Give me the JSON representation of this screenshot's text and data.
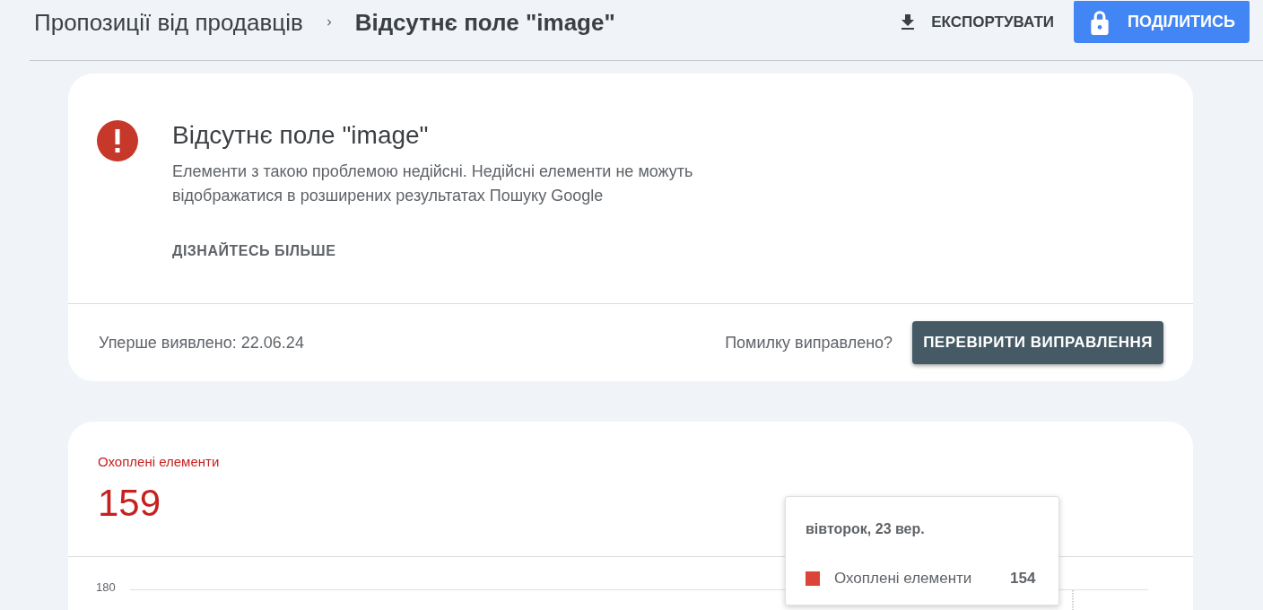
{
  "breadcrumb": [
    {
      "label": "Пропозиції від продавців"
    },
    {
      "label": "Відсутнє поле \"image\""
    }
  ],
  "actions": {
    "export": "ЕКСПОРТУВАТИ",
    "share": "ПОДІЛИТИСЬ"
  },
  "issue": {
    "title": "Відсутнє поле \"image\"",
    "description": "Елементи з такою проблемою недійсні. Недійсні елементи не можуть відображатися в розширених результатах Пошуку Google",
    "learn_more": "ДІЗНАЙТЕСЬ БІЛЬШЕ",
    "first_detected": "Уперше виявлено: 22.06.24",
    "fixed_question": "Помилку виправлено?",
    "validate_button": "ПЕРЕВІРИТИ ВИПРАВЛЕННЯ"
  },
  "summary": {
    "metric_label": "Охоплені елементи",
    "metric_value": "159",
    "chart": {
      "y_tick": "180",
      "tooltip": {
        "date": "вівторок, 23 вер.",
        "series": "Охоплені елементи",
        "value": "154"
      }
    }
  }
}
